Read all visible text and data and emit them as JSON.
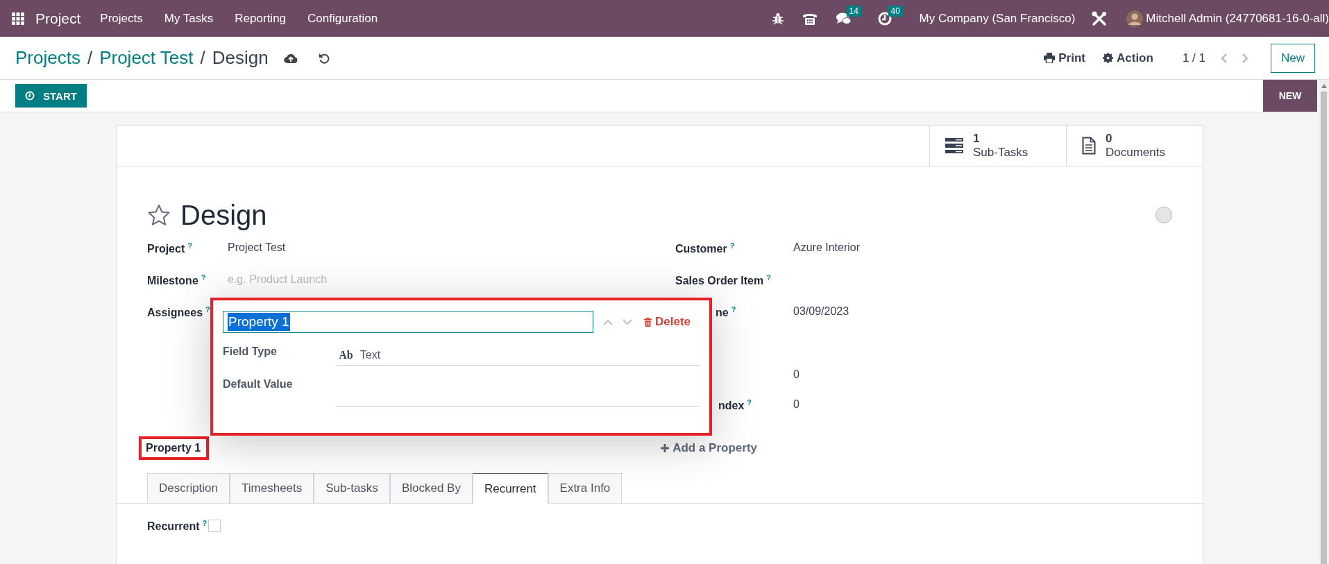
{
  "navbar": {
    "app_name": "Project",
    "menu": [
      "Projects",
      "My Tasks",
      "Reporting",
      "Configuration"
    ],
    "messages_badge": "14",
    "activities_badge": "40",
    "company": "My Company (San Francisco)",
    "user": "Mitchell Admin (24770681-16-0-all)"
  },
  "breadcrumb": [
    {
      "label": "Projects"
    },
    {
      "separator": "/",
      "label": "Project Test"
    },
    {
      "separator": "/",
      "label": "Design"
    }
  ],
  "control_panel": {
    "print": "Print",
    "action": "Action",
    "pager": "1 / 1",
    "new_button": "New"
  },
  "statusbar": {
    "start_button": "START",
    "stage": "NEW"
  },
  "smart_buttons": [
    {
      "kind": "subtasks",
      "count": "1",
      "label": "Sub-Tasks"
    },
    {
      "kind": "documents",
      "count": "0",
      "label": "Documents"
    }
  ],
  "title": "Design",
  "starred": false,
  "left_fields": [
    {
      "label": "Project",
      "help": "?",
      "value": "Project Test"
    },
    {
      "label": "Milestone",
      "help": "?",
      "placeholder": "e.g. Product Launch"
    },
    {
      "label": "Assignees",
      "help": "?"
    }
  ],
  "right_fields": [
    {
      "label": "Customer",
      "help": "?",
      "value": "Azure Interior"
    },
    {
      "label": "Sales Order Item",
      "help": "?"
    },
    {
      "label": "ne",
      "help": "?",
      "value": "03/09/2023"
    },
    {
      "value": "0"
    },
    {
      "label": "ndex",
      "help": "?",
      "value": "0"
    }
  ],
  "property": {
    "label": "Property 1",
    "highlighted": true
  },
  "add_property": "Add a Property",
  "popup": {
    "name_value": "Property 1",
    "delete": "Delete",
    "field_type_label": "Field Type",
    "field_type_icon": "Ab",
    "field_type_value": "Text",
    "default_value_label": "Default Value",
    "highlighted": true
  },
  "tabs": [
    {
      "label": "Description",
      "selected": false
    },
    {
      "label": "Timesheets",
      "selected": false
    },
    {
      "label": "Sub-tasks",
      "selected": false
    },
    {
      "label": "Blocked By",
      "selected": false
    },
    {
      "label": "Recurrent",
      "selected": true
    },
    {
      "label": "Extra Info",
      "selected": false
    }
  ],
  "recurrent": {
    "label": "Recurrent",
    "help": "?",
    "checked": false
  }
}
